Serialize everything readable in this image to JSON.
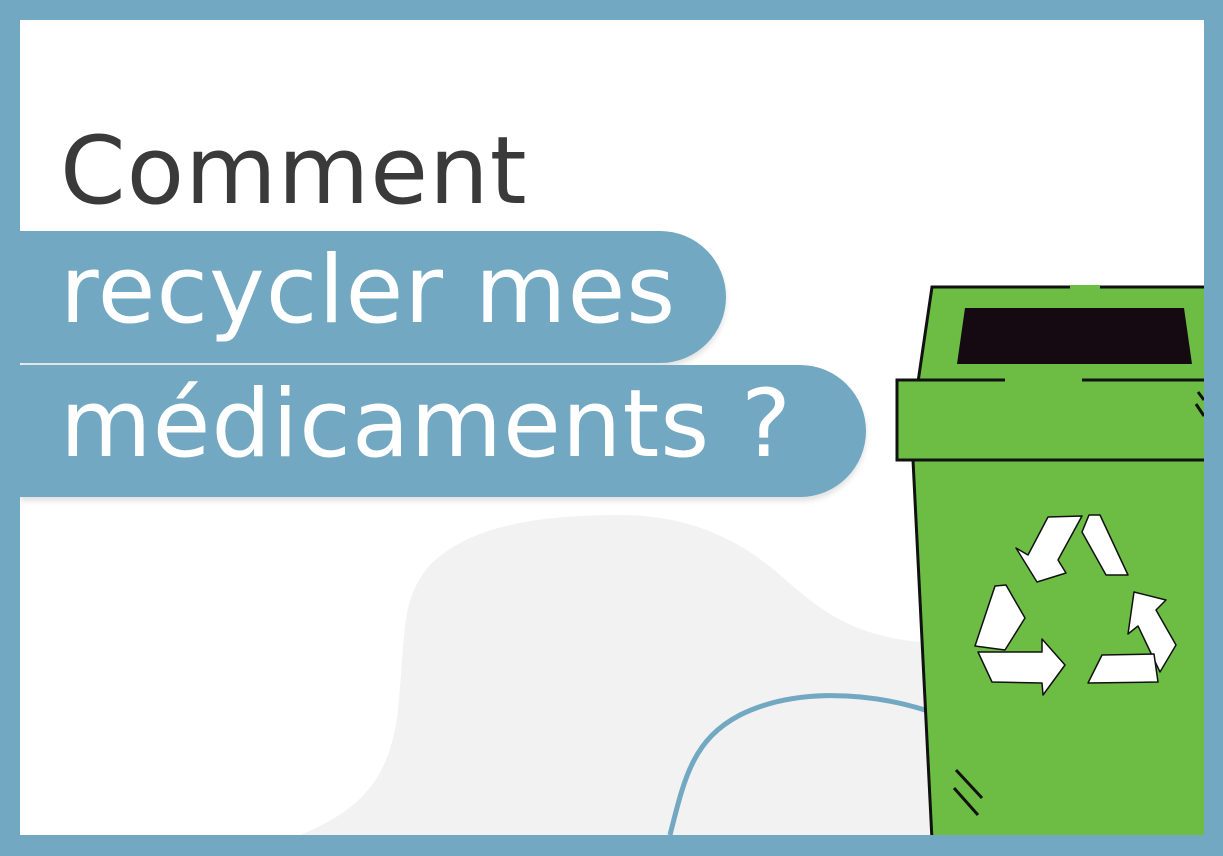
{
  "heading": {
    "line1": "Comment",
    "line2": "recycler mes",
    "line3": "médicaments ?"
  },
  "colors": {
    "frame": "#72a8c1",
    "background": "#ffffff",
    "title_dark": "#3a3a3a",
    "title_light": "#ffffff",
    "band": "#72a8c1",
    "bin_green": "#6dbd45",
    "bin_outline": "#111111",
    "bin_slot": "#150a12",
    "blob": "#f2f2f2",
    "curve": "#72a8c1"
  },
  "illustration": {
    "object": "recycling-bin",
    "symbol": "recycle-icon"
  }
}
